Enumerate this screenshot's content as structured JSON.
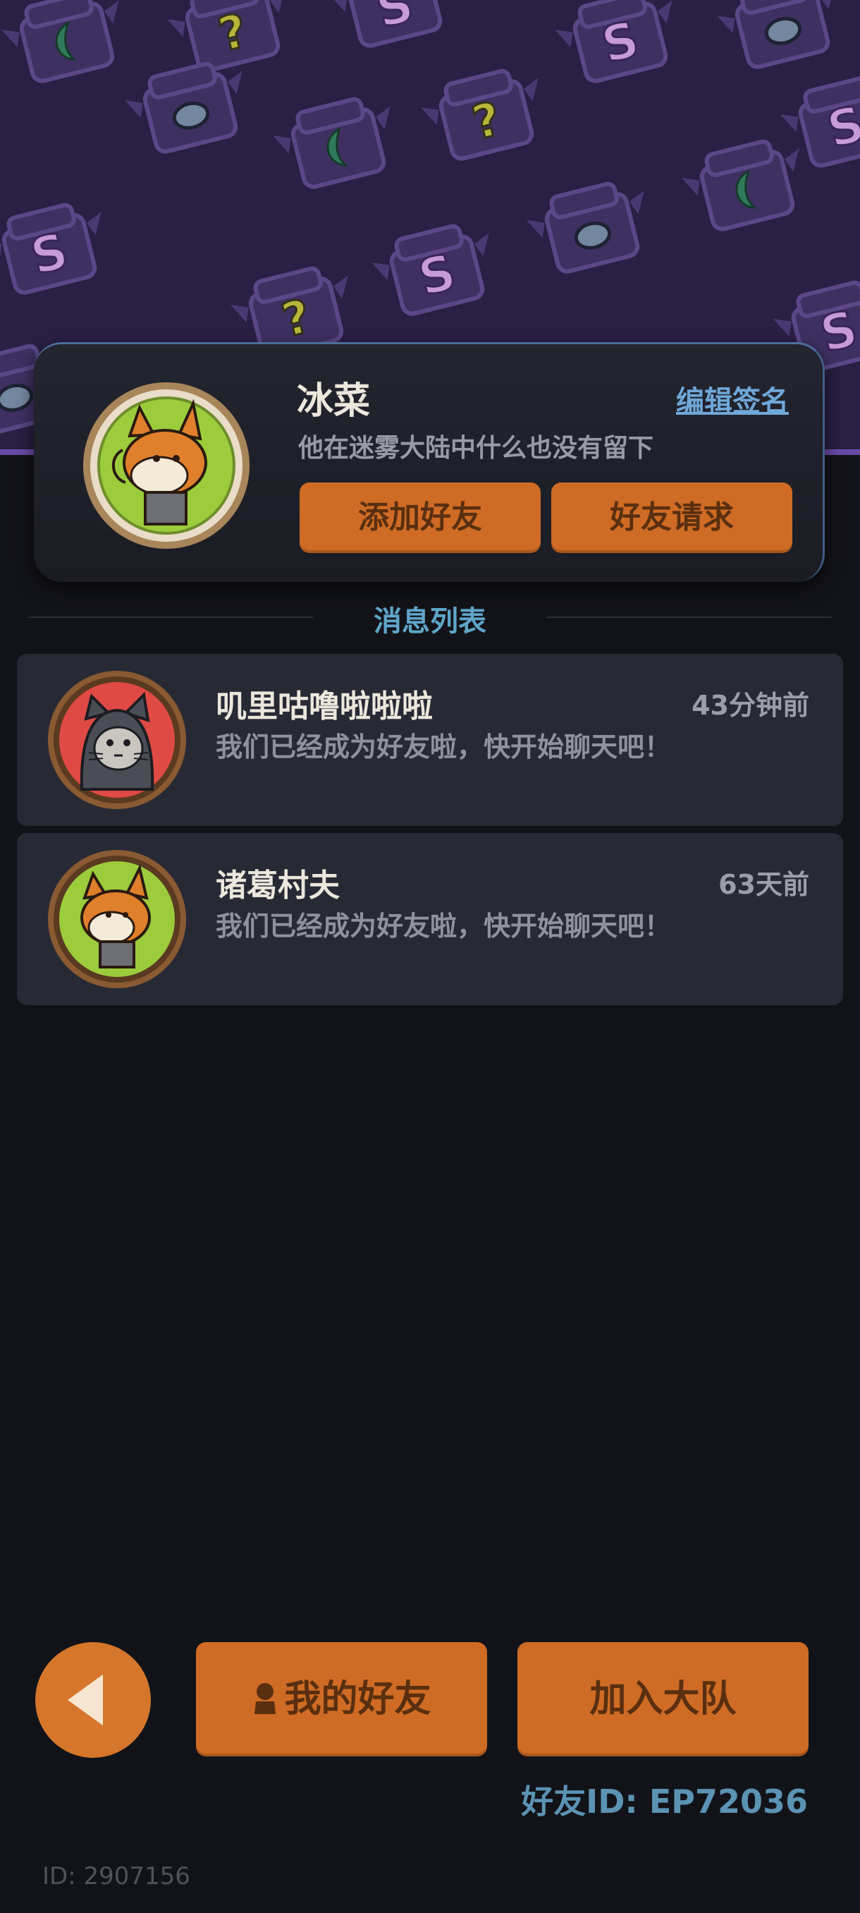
{
  "profile": {
    "name": "冰菜",
    "signature": "他在迷雾大陆中什么也没有留下",
    "edit_signature_label": "编辑签名",
    "add_friend_label": "添加好友",
    "friend_requests_label": "好友请求"
  },
  "messages": {
    "section_title": "消息列表",
    "items": [
      {
        "name": "叽里咕噜啦啦啦",
        "time": "43分钟前",
        "text": "我们已经成为好友啦，快开始聊天吧！",
        "avatar": "cat-avatar-icon"
      },
      {
        "name": "诸葛村夫",
        "time": "63天前",
        "text": "我们已经成为好友啦，快开始聊天吧！",
        "avatar": "fox-avatar-icon"
      }
    ]
  },
  "footer": {
    "my_friends_label": "我的好友",
    "join_team_label": "加入大队",
    "friend_id": "好友ID: EP72036",
    "user_id": "ID: 2907156"
  },
  "colors": {
    "accent_orange": "#cf6b24",
    "background": "#121319",
    "card": "#272a35",
    "link_blue": "#6fa7d8",
    "banner_purple": "#2a1f44"
  }
}
